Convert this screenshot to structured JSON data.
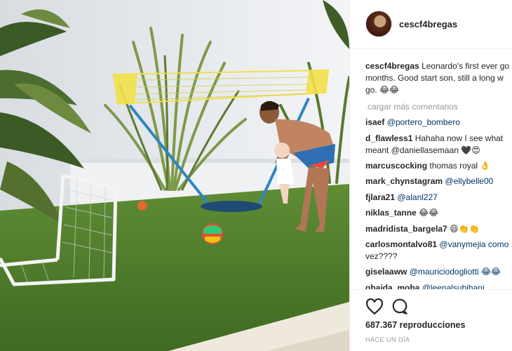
{
  "post": {
    "username": "cescf4bregas",
    "caption_user": "cescf4bregas",
    "caption_text": "Leonardo's first ever go months. Good start son, still a long w go. 😂😂",
    "load_more": "cargar más comentarios",
    "views": "687.367 reproducciones",
    "time_ago": "HACE UN DÍA"
  },
  "comments": [
    {
      "user": "isaef",
      "text": "@portero_bombero",
      "mention": true
    },
    {
      "user": "d_flawless1",
      "text": "Hahaha now I see what",
      "mention": false
    },
    {
      "user": "",
      "text": "meant @daniellasemaan 🖤😍",
      "mention": false
    },
    {
      "user": "marcuscocking",
      "text": "thomas royal 👌",
      "mention": false
    },
    {
      "user": "mark_chynstagram",
      "text": "@ellybelle00",
      "mention": true
    },
    {
      "user": "fjlara21",
      "text": "@alanl227",
      "mention": true
    },
    {
      "user": "niklas_tanne",
      "text": "😂😂",
      "mention": false
    },
    {
      "user": "madridista_bargela7",
      "text": "😄👏👏",
      "mention": false
    },
    {
      "user": "carlosmontalvo81",
      "text": "@vanymejia como",
      "mention": true
    },
    {
      "user": "",
      "text": "vez????",
      "mention": false
    },
    {
      "user": "giselaaww",
      "text": "@mauriciodogliotti 😂😂",
      "mention": true
    },
    {
      "user": "ghaida_moha",
      "text": "@leenalsubihani",
      "mention": true
    }
  ],
  "icons": {
    "like": "heart-icon",
    "comment": "comment-icon"
  },
  "colors": {
    "mention": "#003569",
    "grass": "#4f7a2e",
    "wall": "#e9ecef"
  }
}
